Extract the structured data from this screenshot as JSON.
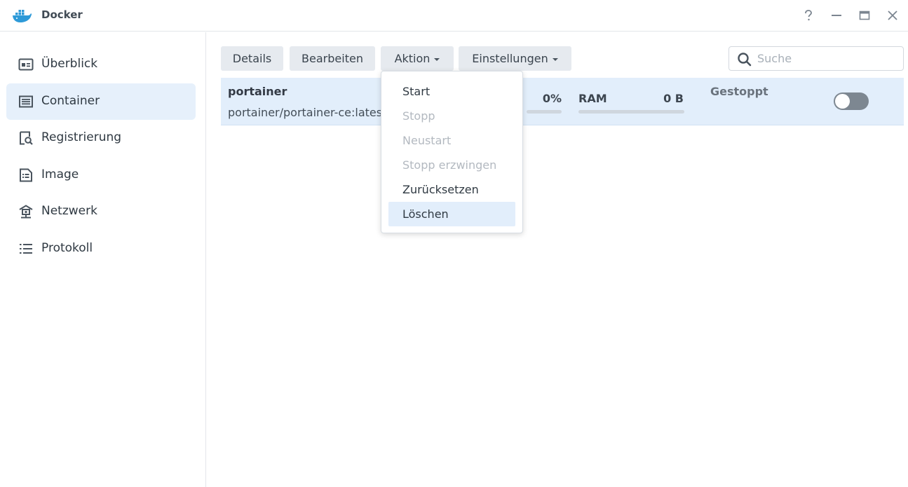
{
  "window": {
    "title": "Docker",
    "controls": [
      "help-icon",
      "minimize-icon",
      "maximize-icon",
      "close-icon"
    ]
  },
  "sidebar": {
    "items": [
      {
        "label": "Überblick",
        "icon": "overview-icon",
        "active": false
      },
      {
        "label": "Container",
        "icon": "container-icon",
        "active": true
      },
      {
        "label": "Registrierung",
        "icon": "registry-icon",
        "active": false
      },
      {
        "label": "Image",
        "icon": "image-icon",
        "active": false
      },
      {
        "label": "Netzwerk",
        "icon": "network-icon",
        "active": false
      },
      {
        "label": "Protokoll",
        "icon": "log-icon",
        "active": false
      }
    ]
  },
  "toolbar": {
    "details_label": "Details",
    "edit_label": "Bearbeiten",
    "action_label": "Aktion",
    "settings_label": "Einstellungen",
    "search_placeholder": "Suche",
    "search_value": ""
  },
  "action_menu": {
    "items": [
      {
        "label": "Start",
        "enabled": true
      },
      {
        "label": "Stopp",
        "enabled": false
      },
      {
        "label": "Neustart",
        "enabled": false
      },
      {
        "label": "Stopp erzwingen",
        "enabled": false
      },
      {
        "label": "Zurücksetzen",
        "enabled": true
      },
      {
        "label": "Löschen",
        "enabled": true,
        "highlighted": true
      }
    ]
  },
  "containers": [
    {
      "name": "portainer",
      "image": "portainer/portainer-ce:latest",
      "cpu": "0%",
      "ram_label": "RAM",
      "ram": "0 B",
      "status": "Gestoppt",
      "running": false
    }
  ],
  "colors": {
    "accent": "#e2eefb",
    "active_sidebar": "#e6f0fb",
    "docker_blue": "#2e9ad8"
  }
}
